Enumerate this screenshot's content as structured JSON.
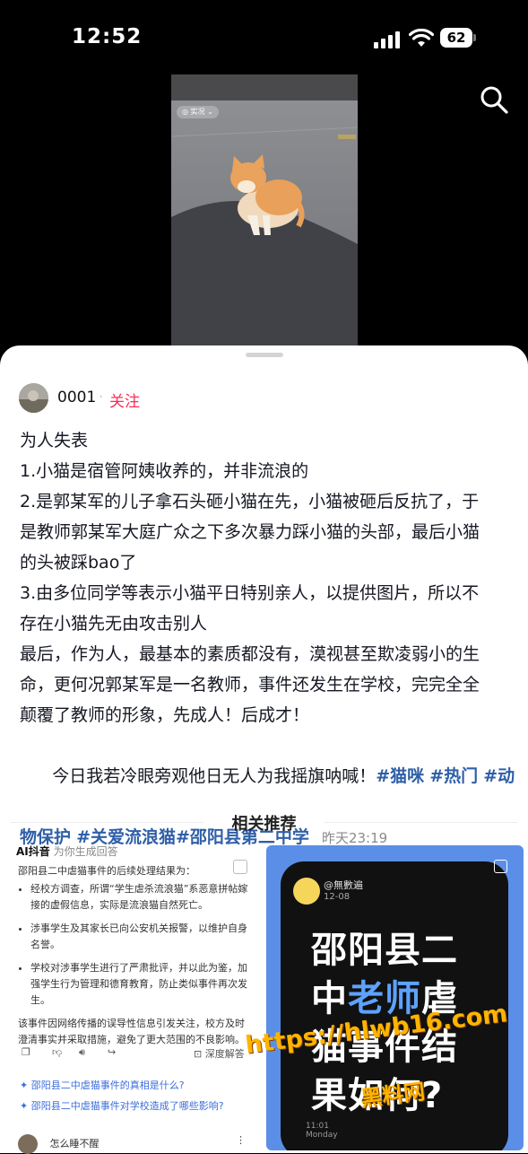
{
  "status_bar": {
    "time": "12:52",
    "battery": "62"
  },
  "video": {
    "badge": "实况"
  },
  "author": {
    "name": "0001",
    "separator": "·",
    "follow_label": "关注"
  },
  "post": {
    "lines": [
      "为人失表",
      "1.小猫是宿管阿姨收养的，并非流浪的",
      "2.是郭某军的儿子拿石头砸小猫在先，小猫被砸后反抗了，于",
      "是教师郭某军大庭广众之下多次暴力踩小猫的头部，最后小猫",
      "的头被踩bao了",
      "3.由多位同学等表示小猫平日特别亲人，以提供图片，所以不",
      "存在小猫先无由攻击别人",
      "最后，作为人，最基本的素质都没有，漠视甚至欺凌弱小的生",
      "命，更何况郭某军是一名教师，事件还发生在学校，完完全全",
      "颠覆了教师的形象，先成人！后成才！"
    ],
    "closing_text": "  今日我若冷眼旁观他日无人为我摇旗呐喊！",
    "tags": [
      "#猫咪",
      "#热门",
      "#动物保护",
      "#关爱流浪猫",
      "#邵阳县第二中学"
    ],
    "timestamp": "昨天23:19"
  },
  "related": {
    "title": "相关推荐"
  },
  "card_left": {
    "header_brand": "AI抖音",
    "header_note": "为你生成回答",
    "question": "邵阳县二中虐猫事件的后续处理结果为：",
    "bullets": [
      "经校方调查，所谓“学生虐杀流浪猫”系恶意拼帖嫁接的虚假信息，实际是流浪猫自然死亡。",
      "涉事学生及其家长已向公安机关报警，以维护自身名誉。",
      "学校对涉事学生进行了严肃批评，并以此为鉴，加强学生行为管理和德育教育，防止类似事件再次发生。"
    ],
    "summary": "该事件因网络传播的误导性信息引发关注，校方及时澄清事实并采取措施，避免了更大范围的不良影响。",
    "deep_answer": "深度解答",
    "followups": [
      "邵阳县二中虐猫事件的真相是什么?",
      "邵阳县二中虐猫事件对学校造成了哪些影响?"
    ],
    "user": "怎么睡不醒"
  },
  "card_right": {
    "account": "@無數遍",
    "date": "12-08",
    "title_before": "邵阳县二中",
    "title_highlight": "老师",
    "title_after": "虐猫事件结果如何?",
    "footer_time": "11:01",
    "footer_day": "Monday"
  },
  "watermark": {
    "url": "https://hlwb16.com",
    "name": "黑料网"
  },
  "colors": {
    "accent": "#fe2c55",
    "tag": "#2f5fa7",
    "card_blue": "#5b8fe7"
  }
}
